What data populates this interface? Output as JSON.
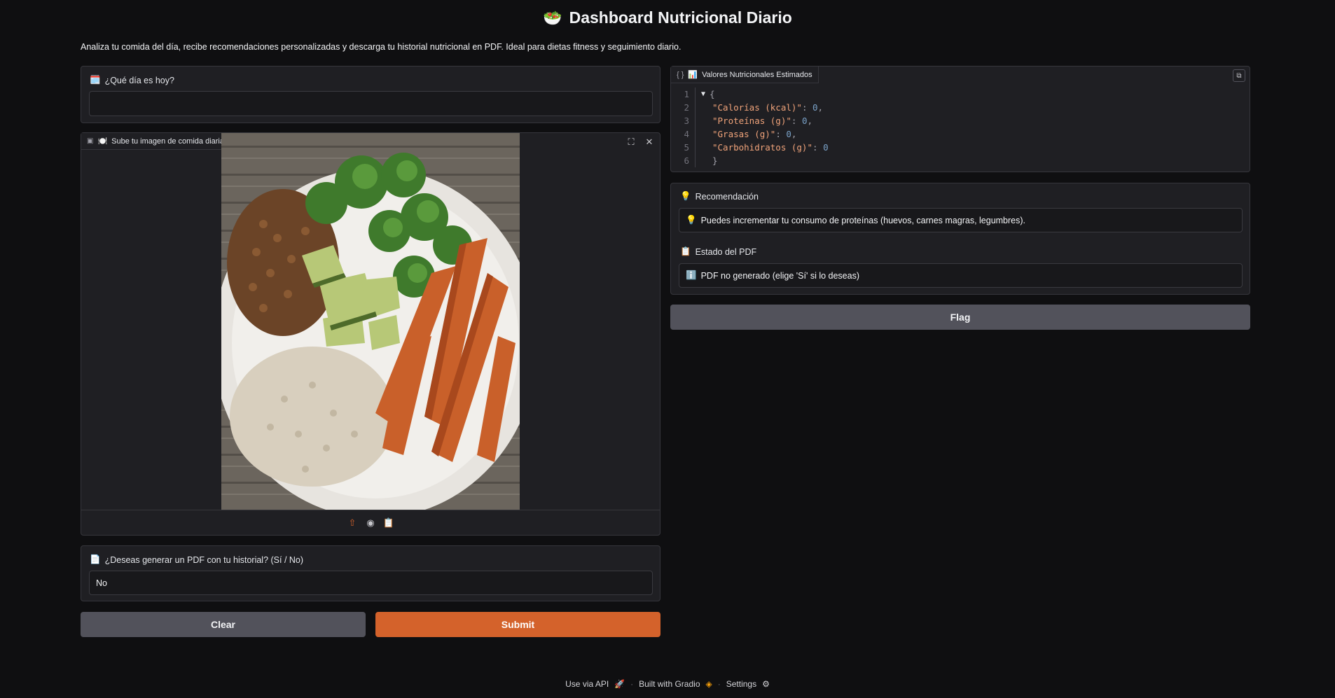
{
  "header": {
    "title": "Dashboard Nutricional Diario",
    "title_icon": "salad-bowl-icon",
    "description": "Analiza tu comida del día, recibe recomendaciones personalizadas y descarga tu historial nutricional en PDF. Ideal para dietas fitness y seguimiento diario."
  },
  "day_input": {
    "label": "¿Qué día es hoy?",
    "icon": "calendar-icon",
    "value": ""
  },
  "image_upload": {
    "label": "Sube tu imagen de comida diaria",
    "icon": "image-icon"
  },
  "pdf_input": {
    "label": "¿Deseas generar un PDF con tu historial? (Sí / No)",
    "icon": "document-icon",
    "value": "No"
  },
  "buttons": {
    "clear": "Clear",
    "submit": "Submit",
    "flag": "Flag"
  },
  "json_output": {
    "label": "Valores Nutricionales Estimados",
    "icon": "bar-chart-icon",
    "lines": [
      "1",
      "2",
      "3",
      "4",
      "5",
      "6"
    ],
    "open_brace": "{",
    "close_brace": "}",
    "entries": [
      {
        "key": "\"Calorías (kcal)\"",
        "value": "0",
        "sep": ","
      },
      {
        "key": "\"Proteínas (g)\"",
        "value": "0",
        "sep": ","
      },
      {
        "key": "\"Grasas (g)\"",
        "value": "0",
        "sep": ","
      },
      {
        "key": "\"Carbohidratos (g)\"",
        "value": "0",
        "sep": ""
      }
    ]
  },
  "recommendation": {
    "label": "Recomendación",
    "icon": "lightbulb-icon",
    "text": "Puedes incrementar tu consumo de proteínas (huevos, carnes magras, legumbres)."
  },
  "pdf_status": {
    "label": "Estado del PDF",
    "icon": "clipboard-icon",
    "text": "PDF no generado (elige 'Sí' si lo deseas)"
  },
  "footer": {
    "api": "Use via API",
    "built": "Built with Gradio",
    "settings": "Settings"
  },
  "colors": {
    "accent": "#d4622b",
    "background": "#0f0f11",
    "panel": "#1f1f23"
  }
}
